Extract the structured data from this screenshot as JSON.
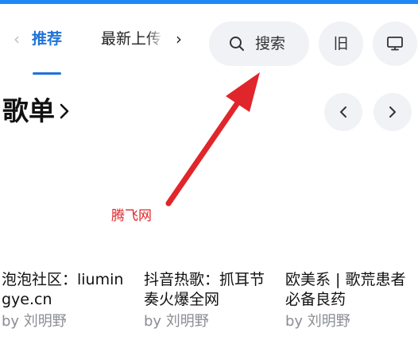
{
  "tabs": {
    "items": [
      {
        "label": "推荐",
        "display": "推荐",
        "active": true
      },
      {
        "label": "最新上传",
        "display": "最新上传",
        "active": false
      }
    ]
  },
  "header": {
    "search_label": "搜索",
    "old_label": "旧"
  },
  "section": {
    "title": "歌单"
  },
  "watermark": "腾飞网",
  "cards": [
    {
      "title": "泡泡社区：liumingye.cn",
      "author": "by 刘明野"
    },
    {
      "title": "抖音热歌：抓耳节奏火爆全网",
      "author": "by 刘明野"
    },
    {
      "title": "欧美系 | 歌荒患者必备良药",
      "author": "by 刘明野"
    }
  ],
  "colors": {
    "accent": "#1e73d8",
    "top_strip": "#1e88f5",
    "button_bg": "#f0f2f5",
    "annotation_red": "#e0262b",
    "muted_text": "#8a8d93"
  },
  "icons": {
    "tab_prev": "chevron-left-icon",
    "tab_next": "chevron-right-icon",
    "search": "search-icon",
    "device": "monitor-icon",
    "section_more": "chevron-right-icon",
    "page_prev": "chevron-left-icon",
    "page_next": "chevron-right-icon"
  }
}
